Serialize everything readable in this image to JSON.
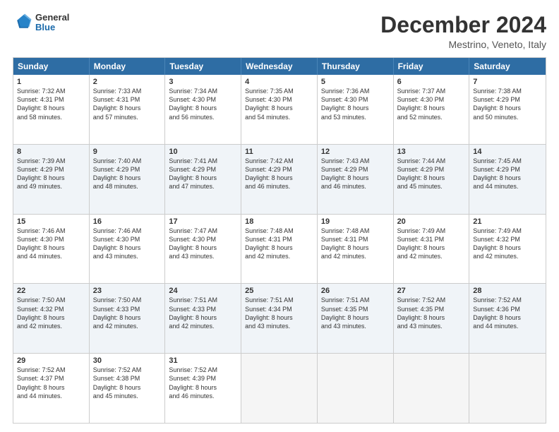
{
  "logo": {
    "general": "General",
    "blue": "Blue"
  },
  "title": "December 2024",
  "location": "Mestrino, Veneto, Italy",
  "days": [
    "Sunday",
    "Monday",
    "Tuesday",
    "Wednesday",
    "Thursday",
    "Friday",
    "Saturday"
  ],
  "weeks": [
    [
      {
        "day": 1,
        "sunrise": "Sunrise: 7:32 AM",
        "sunset": "Sunset: 4:31 PM",
        "daylight": "Daylight: 8 hours and 58 minutes."
      },
      {
        "day": 2,
        "sunrise": "Sunrise: 7:33 AM",
        "sunset": "Sunset: 4:31 PM",
        "daylight": "Daylight: 8 hours and 57 minutes."
      },
      {
        "day": 3,
        "sunrise": "Sunrise: 7:34 AM",
        "sunset": "Sunset: 4:30 PM",
        "daylight": "Daylight: 8 hours and 56 minutes."
      },
      {
        "day": 4,
        "sunrise": "Sunrise: 7:35 AM",
        "sunset": "Sunset: 4:30 PM",
        "daylight": "Daylight: 8 hours and 54 minutes."
      },
      {
        "day": 5,
        "sunrise": "Sunrise: 7:36 AM",
        "sunset": "Sunset: 4:30 PM",
        "daylight": "Daylight: 8 hours and 53 minutes."
      },
      {
        "day": 6,
        "sunrise": "Sunrise: 7:37 AM",
        "sunset": "Sunset: 4:30 PM",
        "daylight": "Daylight: 8 hours and 52 minutes."
      },
      {
        "day": 7,
        "sunrise": "Sunrise: 7:38 AM",
        "sunset": "Sunset: 4:29 PM",
        "daylight": "Daylight: 8 hours and 50 minutes."
      }
    ],
    [
      {
        "day": 8,
        "sunrise": "Sunrise: 7:39 AM",
        "sunset": "Sunset: 4:29 PM",
        "daylight": "Daylight: 8 hours and 49 minutes."
      },
      {
        "day": 9,
        "sunrise": "Sunrise: 7:40 AM",
        "sunset": "Sunset: 4:29 PM",
        "daylight": "Daylight: 8 hours and 48 minutes."
      },
      {
        "day": 10,
        "sunrise": "Sunrise: 7:41 AM",
        "sunset": "Sunset: 4:29 PM",
        "daylight": "Daylight: 8 hours and 47 minutes."
      },
      {
        "day": 11,
        "sunrise": "Sunrise: 7:42 AM",
        "sunset": "Sunset: 4:29 PM",
        "daylight": "Daylight: 8 hours and 46 minutes."
      },
      {
        "day": 12,
        "sunrise": "Sunrise: 7:43 AM",
        "sunset": "Sunset: 4:29 PM",
        "daylight": "Daylight: 8 hours and 46 minutes."
      },
      {
        "day": 13,
        "sunrise": "Sunrise: 7:44 AM",
        "sunset": "Sunset: 4:29 PM",
        "daylight": "Daylight: 8 hours and 45 minutes."
      },
      {
        "day": 14,
        "sunrise": "Sunrise: 7:45 AM",
        "sunset": "Sunset: 4:29 PM",
        "daylight": "Daylight: 8 hours and 44 minutes."
      }
    ],
    [
      {
        "day": 15,
        "sunrise": "Sunrise: 7:46 AM",
        "sunset": "Sunset: 4:30 PM",
        "daylight": "Daylight: 8 hours and 44 minutes."
      },
      {
        "day": 16,
        "sunrise": "Sunrise: 7:46 AM",
        "sunset": "Sunset: 4:30 PM",
        "daylight": "Daylight: 8 hours and 43 minutes."
      },
      {
        "day": 17,
        "sunrise": "Sunrise: 7:47 AM",
        "sunset": "Sunset: 4:30 PM",
        "daylight": "Daylight: 8 hours and 43 minutes."
      },
      {
        "day": 18,
        "sunrise": "Sunrise: 7:48 AM",
        "sunset": "Sunset: 4:31 PM",
        "daylight": "Daylight: 8 hours and 42 minutes."
      },
      {
        "day": 19,
        "sunrise": "Sunrise: 7:48 AM",
        "sunset": "Sunset: 4:31 PM",
        "daylight": "Daylight: 8 hours and 42 minutes."
      },
      {
        "day": 20,
        "sunrise": "Sunrise: 7:49 AM",
        "sunset": "Sunset: 4:31 PM",
        "daylight": "Daylight: 8 hours and 42 minutes."
      },
      {
        "day": 21,
        "sunrise": "Sunrise: 7:49 AM",
        "sunset": "Sunset: 4:32 PM",
        "daylight": "Daylight: 8 hours and 42 minutes."
      }
    ],
    [
      {
        "day": 22,
        "sunrise": "Sunrise: 7:50 AM",
        "sunset": "Sunset: 4:32 PM",
        "daylight": "Daylight: 8 hours and 42 minutes."
      },
      {
        "day": 23,
        "sunrise": "Sunrise: 7:50 AM",
        "sunset": "Sunset: 4:33 PM",
        "daylight": "Daylight: 8 hours and 42 minutes."
      },
      {
        "day": 24,
        "sunrise": "Sunrise: 7:51 AM",
        "sunset": "Sunset: 4:33 PM",
        "daylight": "Daylight: 8 hours and 42 minutes."
      },
      {
        "day": 25,
        "sunrise": "Sunrise: 7:51 AM",
        "sunset": "Sunset: 4:34 PM",
        "daylight": "Daylight: 8 hours and 43 minutes."
      },
      {
        "day": 26,
        "sunrise": "Sunrise: 7:51 AM",
        "sunset": "Sunset: 4:35 PM",
        "daylight": "Daylight: 8 hours and 43 minutes."
      },
      {
        "day": 27,
        "sunrise": "Sunrise: 7:52 AM",
        "sunset": "Sunset: 4:35 PM",
        "daylight": "Daylight: 8 hours and 43 minutes."
      },
      {
        "day": 28,
        "sunrise": "Sunrise: 7:52 AM",
        "sunset": "Sunset: 4:36 PM",
        "daylight": "Daylight: 8 hours and 44 minutes."
      }
    ],
    [
      {
        "day": 29,
        "sunrise": "Sunrise: 7:52 AM",
        "sunset": "Sunset: 4:37 PM",
        "daylight": "Daylight: 8 hours and 44 minutes."
      },
      {
        "day": 30,
        "sunrise": "Sunrise: 7:52 AM",
        "sunset": "Sunset: 4:38 PM",
        "daylight": "Daylight: 8 hours and 45 minutes."
      },
      {
        "day": 31,
        "sunrise": "Sunrise: 7:52 AM",
        "sunset": "Sunset: 4:39 PM",
        "daylight": "Daylight: 8 hours and 46 minutes."
      },
      null,
      null,
      null,
      null
    ]
  ]
}
